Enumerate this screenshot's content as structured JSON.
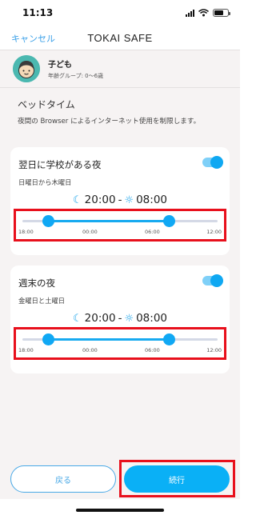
{
  "status_bar": {
    "time": "11:13"
  },
  "nav": {
    "cancel_label": "キャンセル",
    "title": "TOKAI SAFE"
  },
  "profile": {
    "name": "子ども",
    "age_group": "年齢グループ: 0〜6歳",
    "avatar_icon": "child-face-icon"
  },
  "section": {
    "title": "ベッドタイム",
    "description": "夜間の Browser によるインターネット使用を制限します。"
  },
  "schedules": [
    {
      "title": "翌日に学校がある夜",
      "days": "日曜日から木曜日",
      "enabled": true,
      "start": "20:00",
      "end": "08:00",
      "separator": "-",
      "start_fraction": 0.13,
      "end_fraction": 0.75,
      "ticks": [
        "18:00",
        "00:00",
        "06:00",
        "12:00"
      ]
    },
    {
      "title": "週末の夜",
      "days": "金曜日と土曜日",
      "enabled": true,
      "start": "20:00",
      "end": "08:00",
      "separator": "-",
      "start_fraction": 0.13,
      "end_fraction": 0.75,
      "ticks": [
        "18:00",
        "00:00",
        "06:00",
        "12:00"
      ]
    }
  ],
  "footer": {
    "back_label": "戻る",
    "next_label": "続行"
  },
  "colors": {
    "accent": "#0ab0f6",
    "highlight": "#e8101c",
    "background": "#f6f3f3"
  },
  "icons": {
    "start": "moon-icon",
    "end": "sun-icon"
  }
}
